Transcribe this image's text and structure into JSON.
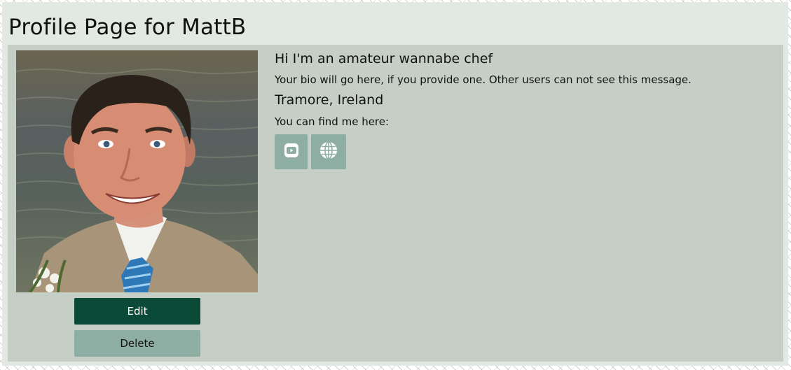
{
  "page": {
    "title": "Profile Page for MattB"
  },
  "profile": {
    "avatar_alt": "Profile photo of MattB",
    "tagline": "Hi I'm an amateur wannabe chef",
    "bio": "Your bio will go here, if you provide one. Other users can not see this message.",
    "location": "Tramore, Ireland",
    "links_heading": "You can find me here:",
    "links": [
      {
        "icon": "youtube-icon"
      },
      {
        "icon": "globe-icon"
      }
    ]
  },
  "actions": {
    "edit_label": "Edit",
    "delete_label": "Delete"
  },
  "colors": {
    "page_background": "#e2e8e2",
    "card_background": "#c5cfc6",
    "primary_button": "#0b4a37",
    "secondary_button": "#8faea3"
  }
}
